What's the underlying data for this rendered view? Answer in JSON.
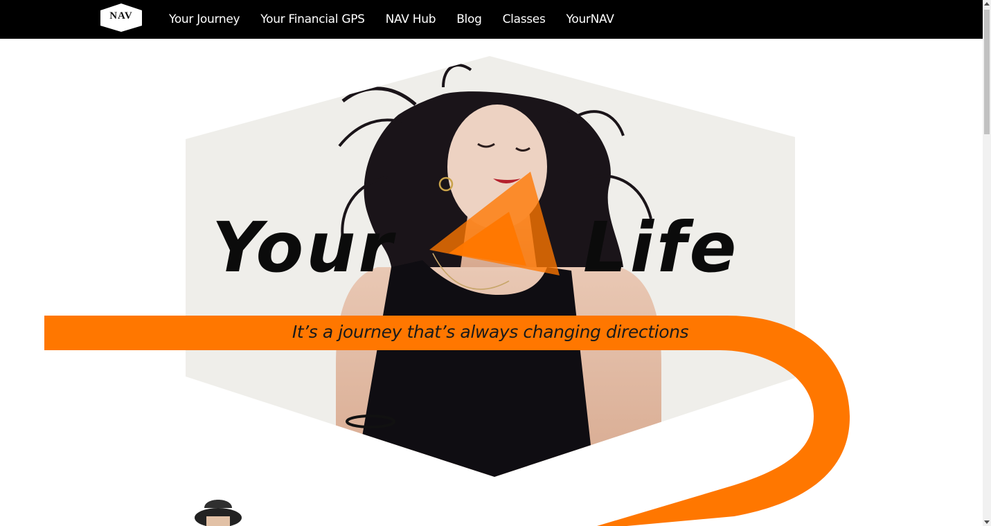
{
  "brand": {
    "logo_text": "NAV"
  },
  "nav": {
    "items": [
      {
        "label": "Your Journey"
      },
      {
        "label": "Your Financial GPS"
      },
      {
        "label": "NAV Hub"
      },
      {
        "label": "Blog"
      },
      {
        "label": "Classes"
      },
      {
        "label": "YourNAV"
      }
    ]
  },
  "hero": {
    "headline_left": "Your",
    "headline_right": "Life",
    "tagline": "It’s a journey that’s always changing directions"
  },
  "colors": {
    "nav_background": "#000000",
    "accent_orange": "#ff7700",
    "hexagon_background": "#efeeea",
    "headline_text": "#0b0b0b"
  },
  "icons": {
    "logo": "hexagon-logo-icon",
    "arrow": "orange-arrow-icon",
    "person": "hat-person-avatar"
  }
}
